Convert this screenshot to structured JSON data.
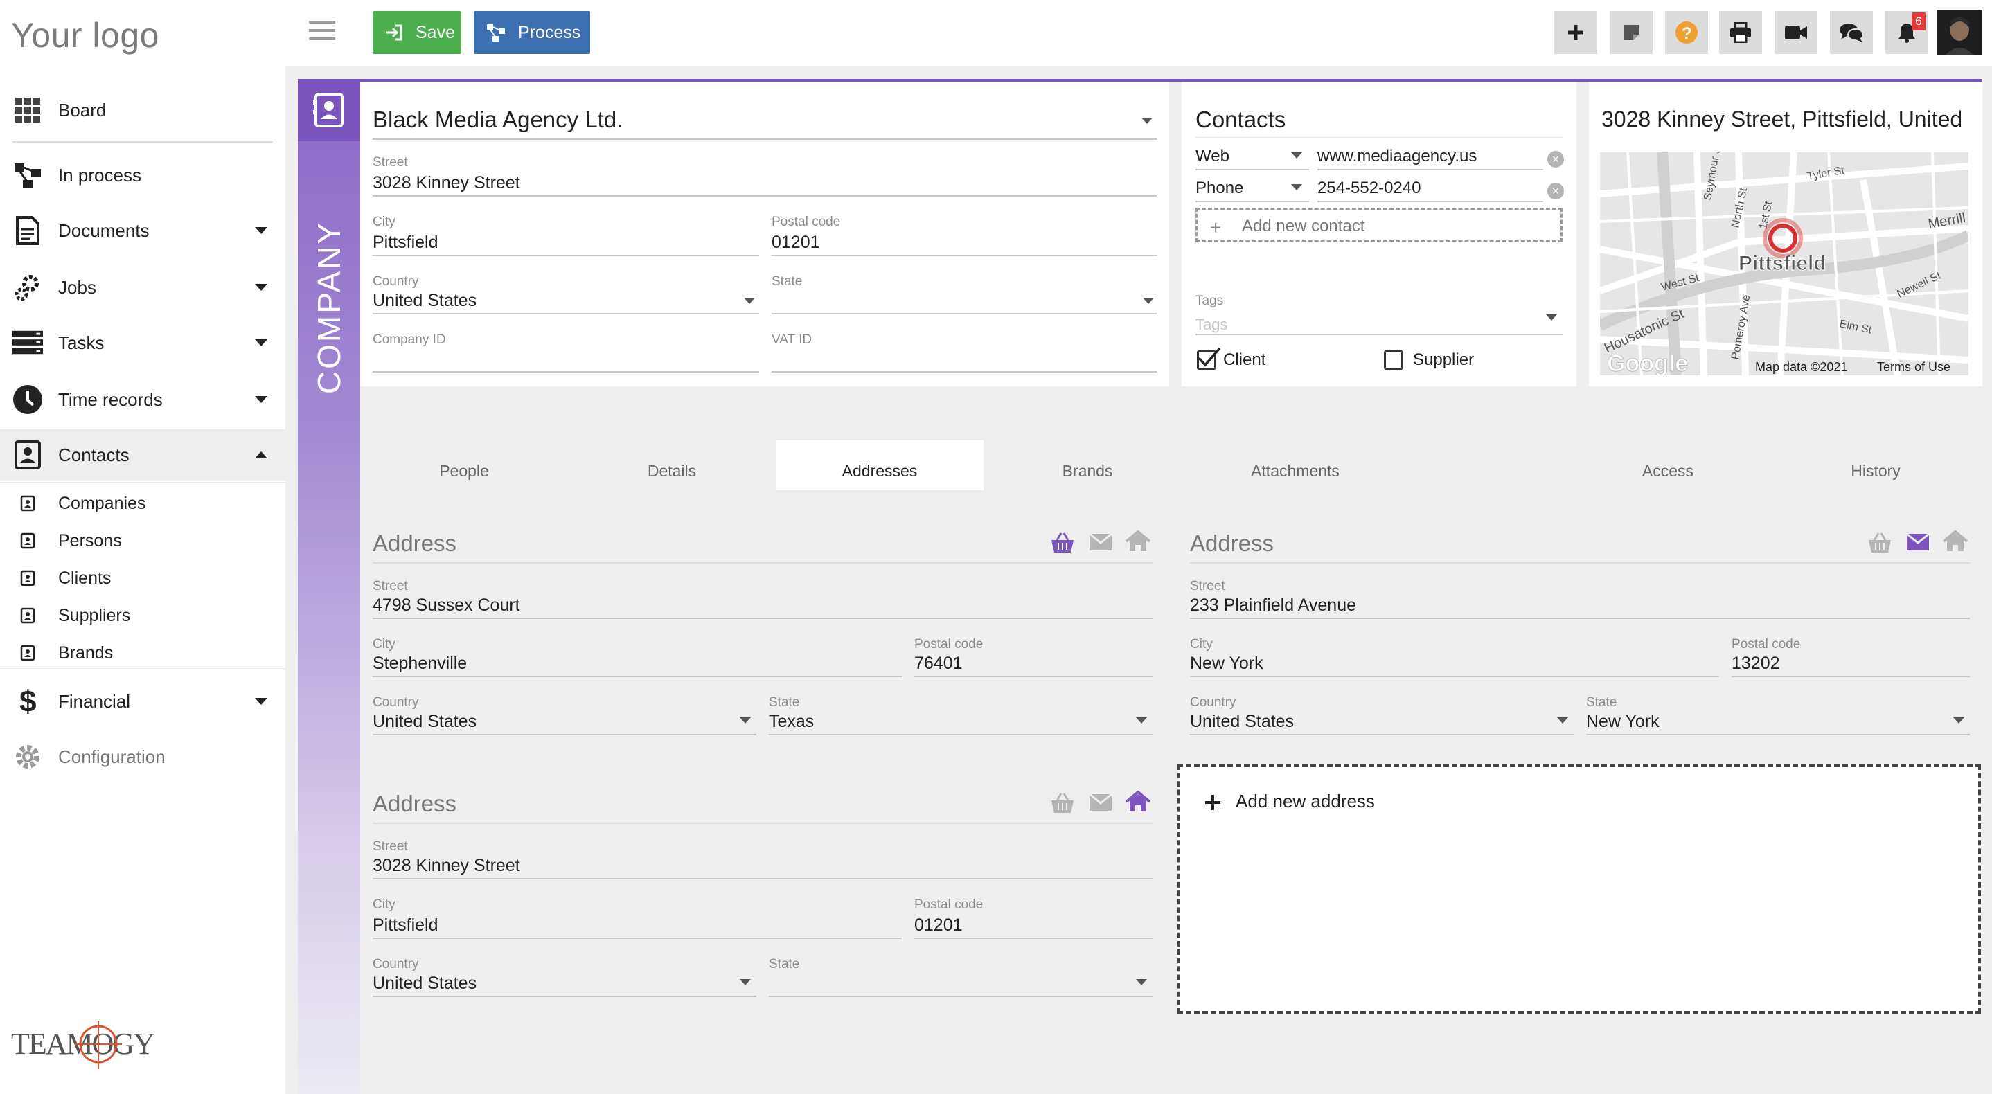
{
  "app": {
    "logo_text": "Your logo",
    "brand_name": "TEAMOGY"
  },
  "sidebar": {
    "items": [
      {
        "label": "Board",
        "icon": "grid-icon"
      },
      {
        "label": "In process",
        "icon": "process-icon"
      },
      {
        "label": "Documents",
        "icon": "document-icon"
      },
      {
        "label": "Jobs",
        "icon": "gears-icon"
      },
      {
        "label": "Tasks",
        "icon": "tasks-icon"
      },
      {
        "label": "Time records",
        "icon": "clock-icon"
      },
      {
        "label": "Contacts",
        "icon": "contacts-icon"
      },
      {
        "label": "Financial",
        "icon": "dollar-icon"
      },
      {
        "label": "Configuration",
        "icon": "gear-icon"
      }
    ],
    "contacts_sub": [
      {
        "label": "Companies"
      },
      {
        "label": "Persons"
      },
      {
        "label": "Clients"
      },
      {
        "label": "Suppliers"
      },
      {
        "label": "Brands"
      }
    ]
  },
  "toolbar": {
    "save_label": "Save",
    "process_label": "Process",
    "notification_count": "6"
  },
  "rail": {
    "label": "COMPANY"
  },
  "company": {
    "name": "Black Media Agency Ltd.",
    "street_label": "Street",
    "street": "3028 Kinney Street",
    "city_label": "City",
    "city": "Pittsfield",
    "postal_label": "Postal code",
    "postal": "01201",
    "country_label": "Country",
    "country": "United States",
    "state_label": "State",
    "state": "",
    "company_id_label": "Company ID",
    "company_id": "",
    "vat_label": "VAT ID",
    "vat": ""
  },
  "contacts": {
    "title": "Contacts",
    "rows": [
      {
        "type": "Web",
        "value": "www.mediaagency.us"
      },
      {
        "type": "Phone",
        "value": "254-552-0240"
      }
    ],
    "add_label": "Add new contact",
    "tags_label": "Tags",
    "tags_placeholder": "Tags",
    "client_label": "Client",
    "client_checked": true,
    "supplier_label": "Supplier",
    "supplier_checked": false
  },
  "map": {
    "title": "3028 Kinney Street, Pittsfield, United",
    "place_label": "Pittsfield",
    "streets": [
      "Tyler St",
      "Seymour St",
      "North St",
      "1st St",
      "Merrill",
      "West St",
      "Newell St",
      "Housatonic St",
      "Elm St",
      "Pomeroy Ave"
    ],
    "provider": "Google",
    "map_data": "Map data ©2021",
    "terms": "Terms of Use"
  },
  "tabs": [
    {
      "label": "People"
    },
    {
      "label": "Details"
    },
    {
      "label": "Addresses",
      "active": true
    },
    {
      "label": "Brands"
    },
    {
      "label": "Attachments"
    },
    {
      "label": "Access"
    },
    {
      "label": "History"
    }
  ],
  "addresses": [
    {
      "title": "Address",
      "street_label": "Street",
      "street": "4798 Sussex Court",
      "city_label": "City",
      "city": "Stephenville",
      "postal_label": "Postal code",
      "postal": "76401",
      "country_label": "Country",
      "country": "United States",
      "state_label": "State",
      "state": "Texas",
      "active_icon": "basket"
    },
    {
      "title": "Address",
      "street_label": "Street",
      "street": "233 Plainfield Avenue",
      "city_label": "City",
      "city": "New York",
      "postal_label": "Postal code",
      "postal": "13202",
      "country_label": "Country",
      "country": "United States",
      "state_label": "State",
      "state": "New York",
      "active_icon": "mail"
    },
    {
      "title": "Address",
      "street_label": "Street",
      "street": "3028 Kinney Street",
      "city_label": "City",
      "city": "Pittsfield",
      "postal_label": "Postal code",
      "postal": "01201",
      "country_label": "Country",
      "country": "United States",
      "state_label": "State",
      "state": "",
      "active_icon": "home"
    }
  ],
  "add_address_label": "Add new address",
  "colors": {
    "accent": "#7b55bd",
    "save": "#4cae4c",
    "process": "#3c6fb0",
    "badge": "#e03a3a",
    "help": "#f0a030"
  }
}
